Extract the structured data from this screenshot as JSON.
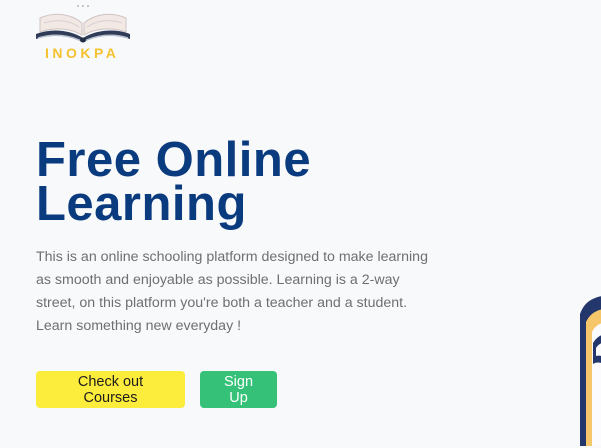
{
  "brand": {
    "name": "INOKPA",
    "logo_icon": "open-book-icon"
  },
  "hero": {
    "title_line1": "Free Online",
    "title_line2": "Learning",
    "description": "This is an online schooling platform designed to make learning as smooth and enjoyable as possible. Learning is a 2-way street, on this platform you're both a teacher and a student. Learn something new everyday !"
  },
  "actions": {
    "courses_label": "Check out Courses",
    "signup_label": "Sign Up"
  },
  "colors": {
    "background": "#f8f9fb",
    "title": "#0a3b7e",
    "brand_yellow": "#f4c230",
    "courses_button": "#fcec3c",
    "signup_button": "#35c177"
  },
  "decoration": {
    "icon": "book-illustration-icon"
  }
}
